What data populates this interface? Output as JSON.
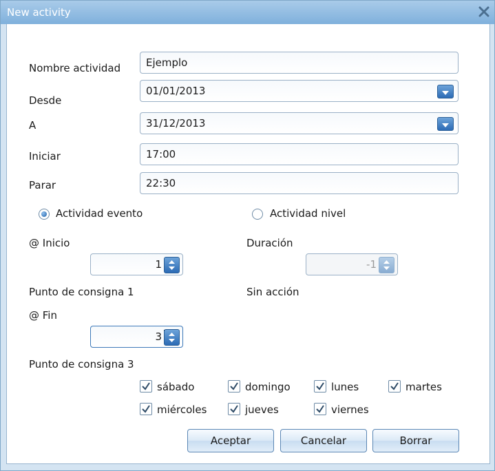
{
  "window": {
    "title": "New activity"
  },
  "form": {
    "nombre_label": "Nombre actividad",
    "nombre_value": "Ejemplo",
    "desde_label": "Desde",
    "desde_value": "01/01/2013",
    "a_label": "A",
    "a_value": "31/12/2013",
    "iniciar_label": "Iniciar",
    "iniciar_value": "17:00",
    "parar_label": "Parar",
    "parar_value": "22:30"
  },
  "mode": {
    "evento_label": "Actividad evento",
    "nivel_label": "Actividad nivel",
    "selected": "evento"
  },
  "evento": {
    "inicio_label": "@ Inicio",
    "inicio_value": "1",
    "inicio_caption": "Punto de consigna 1",
    "fin_label": "@ Fin",
    "fin_value": "3",
    "fin_caption": "Punto de consigna 3"
  },
  "nivel": {
    "duracion_label": "Duración",
    "duracion_value": "-1",
    "duracion_caption": "Sin acción"
  },
  "days": [
    {
      "label": "sábado",
      "checked": true
    },
    {
      "label": "domingo",
      "checked": true
    },
    {
      "label": "lunes",
      "checked": true
    },
    {
      "label": "martes",
      "checked": true
    },
    {
      "label": "miércoles",
      "checked": true
    },
    {
      "label": "jueves",
      "checked": true
    },
    {
      "label": "viernes",
      "checked": true
    }
  ],
  "buttons": {
    "aceptar": "Aceptar",
    "cancelar": "Cancelar",
    "borrar": "Borrar"
  },
  "icons": {
    "close": "close-icon",
    "dropdown": "chevron-down-icon",
    "spinner": "spinner-arrows-icon",
    "check": "checkmark-icon"
  },
  "colors": {
    "accent": "#2c6bb5",
    "titlebar": "#7fb0dc",
    "window_bg": "#d4e4f2"
  }
}
